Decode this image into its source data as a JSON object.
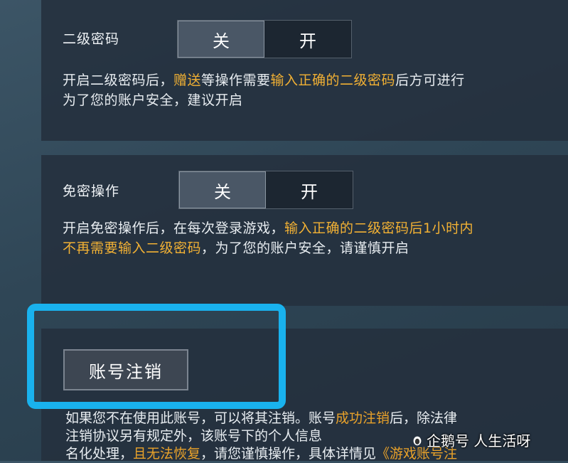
{
  "section1": {
    "title": "二级密码",
    "toggle_off": "关",
    "toggle_on": "开",
    "desc_line1_a": "开启二级密码后，",
    "desc_line1_b": "赠送",
    "desc_line1_c": "等操作需要",
    "desc_line1_d": "输入正确的二级密码",
    "desc_line1_e": "后方可进行",
    "desc_line2": "为了您的账户安全，建议开启"
  },
  "section2": {
    "title": "免密操作",
    "toggle_off": "关",
    "toggle_on": "开",
    "desc_line1_a": "开启免密操作后，在每次登录游戏，",
    "desc_line1_b": "输入正确的二级密码后1小时内",
    "desc_line2_a": "不再需要输入二级密码",
    "desc_line2_b": "，为了您的账户安全，请谨慎开启"
  },
  "section3": {
    "button_label": "账号注销",
    "desc_line1_a": "如果您不在使用此账号，可以将其注销。账号",
    "desc_line1_b": "成功注销",
    "desc_line1_c": "后，除法律",
    "desc_line2": "注销协议另有规定外，该账号下的个人信息",
    "desc_line3_a": "名化处理，",
    "desc_line3_b": "且无法恢复",
    "desc_line3_c": "，请您谨慎操作，具体详情见",
    "desc_line3_d": "《游戏账号注"
  },
  "watermark": {
    "text": "企鹅号 人生活呀"
  },
  "colors": {
    "highlight_border": "#19b2ee",
    "accent_text": "#f2b134"
  }
}
